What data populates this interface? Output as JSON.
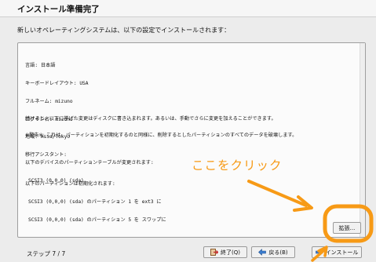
{
  "window": {
    "title": "インストール準備完了",
    "intro": "新しいオペレーティングシステムは、以下の設定でインストールされます："
  },
  "summary": {
    "lines": [
      "言語: 日本語",
      "キーボードレイアウト: USA",
      "フルネーム: mizuno",
      "ログイン名: mizuno",
      "地域: Asia/Tokyo",
      "移行アシスタント:"
    ],
    "continue_notice": "続けると、以下に挙げた変更はディスクに書き込まれます。あるいは、手動でさらに変更を加えることができます。",
    "warning": "※警告※: これは、パーティションを初期化するのと同様に、削除するとしたパーティションのすべてのデータを破壊します。",
    "table_heading": "以下のデバイスのパーティションテーブルが変更されます:",
    "table_device": "SCSI3 (0,0,0) (sda)",
    "init_heading": "以下のパーティションは初期化されます:",
    "init_line1": "SCSI3 (0,0,0) (sda) のパーティション 1 を ext3 に",
    "init_line2": "SCSI3 (0,0,0) (sda) のパーティション 5 を スワップに"
  },
  "buttons": {
    "advanced": "拡張...",
    "quit": "終了(Q)",
    "back": "戻る(B)",
    "install": "インストール"
  },
  "footer": {
    "step": "ステップ 7 / 7"
  },
  "annotation": {
    "text": "ここをクリック",
    "color": "#f79a16"
  },
  "icons": {
    "quit": "exit-icon",
    "back": "back-arrow-icon",
    "install": "install-arrow-icon"
  }
}
